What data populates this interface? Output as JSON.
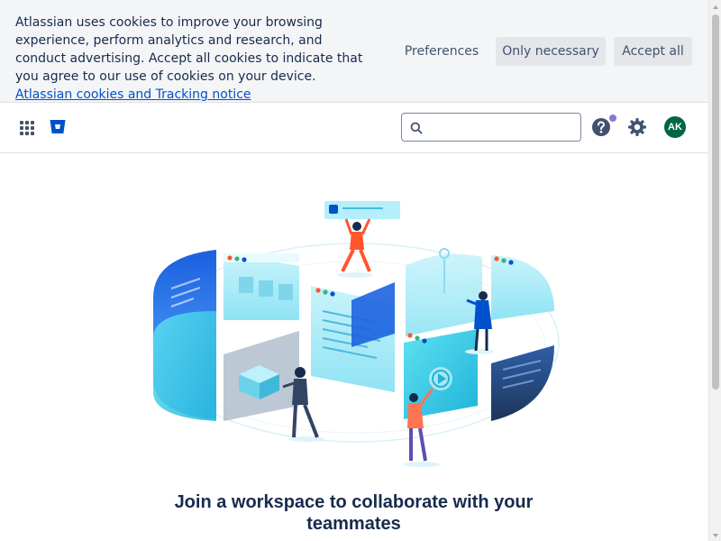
{
  "cookie_banner": {
    "message": "Atlassian uses cookies to improve your browsing experience, perform analytics and research, and conduct advertising. Accept all cookies to indicate that you agree to our use of cookies on your device.",
    "link_text": "Atlassian cookies and Tracking notice",
    "buttons": {
      "preferences": "Preferences",
      "only_necessary": "Only necessary",
      "accept_all": "Accept all"
    }
  },
  "header": {
    "icons": {
      "app_switcher": "app-switcher-grid-icon",
      "logo": "bitbucket-logo-icon",
      "search": "search-icon",
      "help": "help-icon",
      "settings": "gear-icon"
    },
    "search": {
      "value": "",
      "placeholder": ""
    },
    "avatar_initials": "AK",
    "colors": {
      "brand": "#0052cc",
      "avatar": "#006644",
      "notification": "#8777d9"
    }
  },
  "main": {
    "illustration": "workspace-collaboration-illustration",
    "heading": "Join a workspace to collaborate with your teammates"
  }
}
